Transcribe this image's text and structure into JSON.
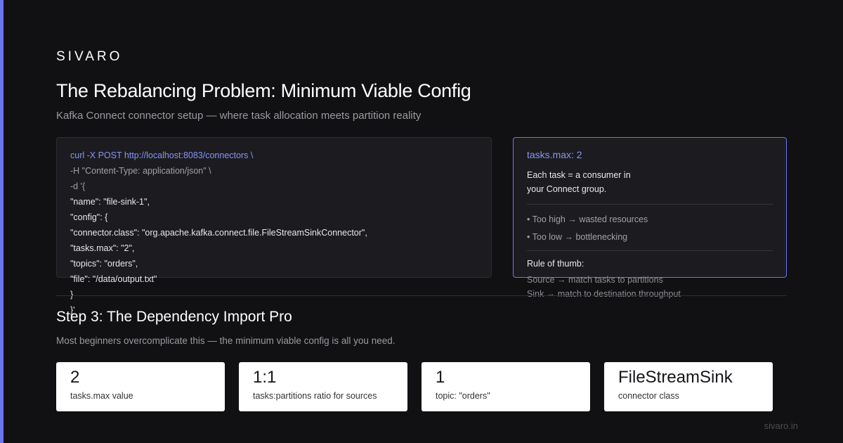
{
  "brand": "SIVARO",
  "title": "The Rebalancing Problem: Minimum Viable Config",
  "subtitle": "Kafka Connect connector setup — where task allocation meets partition reality",
  "code": {
    "lines": [
      "curl -X POST http://localhost:8083/connectors \\",
      "-H \"Content-Type: application/json\" \\",
      "-d '{",
      "\"name\": \"file-sink-1\",",
      "\"config\": {",
      "\"connector.class\": \"org.apache.kafka.connect.file.FileStreamSinkConnector\",",
      "\"tasks.max\": \"2\",",
      "\"topics\": \"orders\",",
      "\"file\": \"/data/output.txt\"",
      "}",
      "}'"
    ]
  },
  "note": {
    "title": "tasks.max: 2",
    "body_line1": "Each task = a consumer in",
    "body_line2": "your Connect group.",
    "bullets": [
      "• Too high → wasted resources",
      "• Too low → bottlenecking"
    ],
    "rule_heading": "Rule of thumb:",
    "rule_lines": [
      "Source → match tasks to partitions",
      "Sink → match to destination throughput"
    ]
  },
  "section": {
    "heading": "Step 3: The Dependency Import Pro",
    "description": "Most beginners overcomplicate this — the minimum viable config is all you need."
  },
  "stats": [
    {
      "value": "2",
      "label": "tasks.max value"
    },
    {
      "value": "1:1",
      "label": "tasks:partitions ratio for sources"
    },
    {
      "value": "1",
      "label": "topic: \"orders\""
    },
    {
      "value": "FileStreamSink",
      "label": "connector class"
    }
  ],
  "footer": "sivaro.in",
  "colors": {
    "background": "#111113",
    "accent": "#6b73f0",
    "accent_text": "#8b92f5",
    "card": "#ffffff"
  }
}
